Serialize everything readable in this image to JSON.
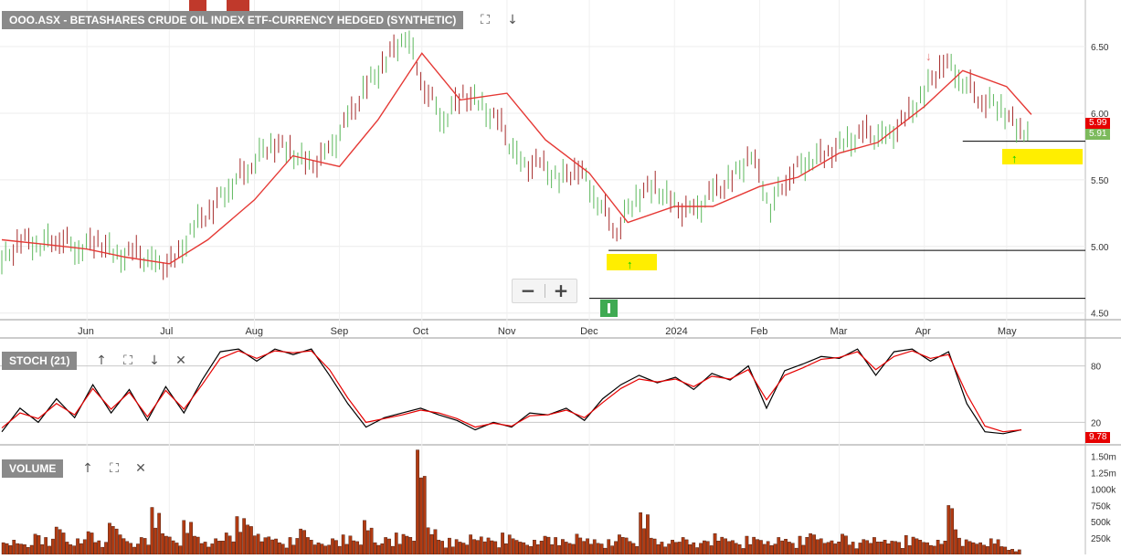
{
  "chart_data": [
    {
      "type": "line",
      "panel": "price",
      "title": "OOO.ASX - BETASHARES CRUDE OIL INDEX ETF-CURRENCY HEDGED (SYNTHETIC)",
      "x_tick_labels": [
        "Jun",
        "Jul",
        "Aug",
        "Sep",
        "Oct",
        "Nov",
        "Dec",
        "2024",
        "Feb",
        "Mar",
        "Apr",
        "May"
      ],
      "y_tick_labels": [
        "6.50",
        "6.00",
        "5.50",
        "5.00",
        "4.50"
      ],
      "ylim": [
        4.45,
        6.85
      ],
      "grid": true,
      "series": [
        {
          "role": "close",
          "color": "#4caf50",
          "points": [
            [
              "2023-05-01",
              4.88
            ],
            [
              "2023-05-08",
              5.05
            ],
            [
              "2023-05-15",
              5.02
            ],
            [
              "2023-05-22",
              5.07
            ],
            [
              "2023-05-29",
              4.98
            ],
            [
              "2023-06-05",
              5.05
            ],
            [
              "2023-06-12",
              4.92
            ],
            [
              "2023-06-19",
              4.95
            ],
            [
              "2023-06-26",
              4.85
            ],
            [
              "2023-07-03",
              4.88
            ],
            [
              "2023-07-10",
              5.15
            ],
            [
              "2023-07-17",
              5.3
            ],
            [
              "2023-07-24",
              5.48
            ],
            [
              "2023-07-31",
              5.62
            ],
            [
              "2023-08-07",
              5.78
            ],
            [
              "2023-08-14",
              5.72
            ],
            [
              "2023-08-21",
              5.6
            ],
            [
              "2023-08-28",
              5.7
            ],
            [
              "2023-09-04",
              5.95
            ],
            [
              "2023-09-11",
              6.2
            ],
            [
              "2023-09-18",
              6.4
            ],
            [
              "2023-09-25",
              6.6
            ],
            [
              "2023-10-02",
              6.2
            ],
            [
              "2023-10-09",
              5.95
            ],
            [
              "2023-10-16",
              6.15
            ],
            [
              "2023-10-23",
              6.05
            ],
            [
              "2023-10-30",
              5.9
            ],
            [
              "2023-11-06",
              5.6
            ],
            [
              "2023-11-13",
              5.62
            ],
            [
              "2023-11-20",
              5.5
            ],
            [
              "2023-11-27",
              5.6
            ],
            [
              "2023-12-04",
              5.35
            ],
            [
              "2023-12-11",
              5.12
            ],
            [
              "2023-12-18",
              5.38
            ],
            [
              "2023-12-25",
              5.45
            ],
            [
              "2024-01-01",
              5.3
            ],
            [
              "2024-01-08",
              5.25
            ],
            [
              "2024-01-15",
              5.4
            ],
            [
              "2024-01-22",
              5.5
            ],
            [
              "2024-01-29",
              5.7
            ],
            [
              "2024-02-05",
              5.3
            ],
            [
              "2024-02-12",
              5.55
            ],
            [
              "2024-02-19",
              5.65
            ],
            [
              "2024-02-26",
              5.7
            ],
            [
              "2024-03-04",
              5.78
            ],
            [
              "2024-03-11",
              5.85
            ],
            [
              "2024-03-18",
              5.8
            ],
            [
              "2024-03-25",
              5.95
            ],
            [
              "2024-04-01",
              6.15
            ],
            [
              "2024-04-08",
              6.4
            ],
            [
              "2024-04-15",
              6.25
            ],
            [
              "2024-04-22",
              6.1
            ],
            [
              "2024-04-29",
              6.05
            ],
            [
              "2024-05-06",
              5.85
            ],
            [
              "2024-05-10",
              5.91
            ]
          ]
        },
        {
          "role": "moving average",
          "color": "#e53935",
          "points": [
            [
              "2023-05-01",
              5.05
            ],
            [
              "2023-05-15",
              5.02
            ],
            [
              "2023-06-01",
              4.98
            ],
            [
              "2023-06-15",
              4.92
            ],
            [
              "2023-07-01",
              4.87
            ],
            [
              "2023-07-15",
              5.05
            ],
            [
              "2023-08-01",
              5.35
            ],
            [
              "2023-08-15",
              5.68
            ],
            [
              "2023-09-01",
              5.6
            ],
            [
              "2023-09-15",
              5.95
            ],
            [
              "2023-10-01",
              6.45
            ],
            [
              "2023-10-15",
              6.1
            ],
            [
              "2023-11-01",
              6.15
            ],
            [
              "2023-11-15",
              5.8
            ],
            [
              "2023-12-01",
              5.55
            ],
            [
              "2023-12-15",
              5.18
            ],
            [
              "2024-01-01",
              5.3
            ],
            [
              "2024-01-15",
              5.3
            ],
            [
              "2024-02-01",
              5.45
            ],
            [
              "2024-02-15",
              5.52
            ],
            [
              "2024-03-01",
              5.7
            ],
            [
              "2024-03-15",
              5.78
            ],
            [
              "2024-04-01",
              6.05
            ],
            [
              "2024-04-15",
              6.32
            ],
            [
              "2024-05-01",
              6.2
            ],
            [
              "2024-05-10",
              5.99
            ]
          ]
        }
      ],
      "horizontal_lines": [
        {
          "label": "resistance",
          "value": 5.79,
          "from": "2024-04-15",
          "to": "2024-05-31"
        },
        {
          "label": "support",
          "value": 4.97,
          "from": "2023-12-08",
          "to": "2024-05-31"
        },
        {
          "label": "low",
          "value": 4.61,
          "from": "2023-12-01",
          "to": "2024-05-31"
        }
      ],
      "price_labels": [
        {
          "text": "5.99",
          "color": "#e60000"
        },
        {
          "text": "5.91",
          "color": "#7cba5c"
        }
      ]
    },
    {
      "type": "line",
      "panel": "stochastic",
      "title": "STOCH (21)",
      "y_tick_labels": [
        "80",
        "20"
      ],
      "ylim": [
        0,
        100
      ],
      "series": [
        {
          "role": "%K",
          "color": "#000000",
          "values": [
            10,
            35,
            20,
            45,
            25,
            60,
            30,
            55,
            22,
            58,
            30,
            65,
            95,
            98,
            85,
            98,
            92,
            98,
            70,
            40,
            15,
            25,
            30,
            35,
            28,
            22,
            12,
            20,
            15,
            30,
            28,
            35,
            22,
            45,
            60,
            70,
            62,
            68,
            55,
            72,
            65,
            80,
            35,
            75,
            82,
            90,
            88,
            98,
            70,
            95,
            98,
            85,
            95,
            40,
            10,
            8,
            12
          ]
        },
        {
          "role": "%D",
          "color": "#e60000",
          "values": [
            14,
            30,
            24,
            40,
            28,
            56,
            34,
            52,
            26,
            54,
            34,
            60,
            88,
            96,
            88,
            96,
            94,
            96,
            76,
            46,
            20,
            24,
            28,
            33,
            30,
            24,
            15,
            19,
            16,
            27,
            28,
            33,
            25,
            41,
            56,
            66,
            63,
            66,
            58,
            69,
            66,
            76,
            44,
            70,
            78,
            87,
            89,
            95,
            76,
            90,
            96,
            88,
            92,
            50,
            16,
            10,
            12
          ]
        }
      ],
      "last_value_label": {
        "text": "9.78",
        "color": "#e60000"
      }
    },
    {
      "type": "bar",
      "panel": "volume",
      "title": "VOLUME",
      "y_tick_labels": [
        "1.50m",
        "1.25m",
        "1000k",
        "750k",
        "500k",
        "250k"
      ],
      "ylim": [
        0,
        1650000
      ],
      "color": "#b23b12",
      "values": [
        180000,
        220000,
        150000,
        310000,
        260000,
        420000,
        190000,
        240000,
        350000,
        210000,
        480000,
        300000,
        170000,
        260000,
        720000,
        320000,
        210000,
        520000,
        280000,
        190000,
        240000,
        330000,
        580000,
        450000,
        310000,
        270000,
        180000,
        260000,
        390000,
        220000,
        160000,
        240000,
        300000,
        210000,
        520000,
        180000,
        260000,
        330000,
        280000,
        1600000,
        410000,
        220000,
        250000,
        190000,
        300000,
        270000,
        210000,
        330000,
        240000,
        180000,
        220000,
        280000,
        260000,
        190000,
        310000,
        240000,
        170000,
        230000,
        300000,
        200000,
        640000,
        250000,
        190000,
        220000,
        260000,
        180000,
        210000,
        320000,
        240000,
        170000,
        280000,
        230000,
        200000,
        260000,
        190000,
        280000,
        320000,
        240000,
        210000,
        310000,
        190000,
        230000,
        260000,
        220000,
        200000,
        290000,
        240000,
        180000,
        220000,
        750000,
        250000,
        200000,
        180000,
        240000,
        120000,
        80000
      ]
    }
  ],
  "price_header": {
    "title": "OOO.ASX - BETASHARES CRUDE OIL INDEX ETF-CURRENCY HEDGED (SYNTHETIC)"
  },
  "stoch_header": {
    "title": "STOCH (21)"
  },
  "volume_header": {
    "title": "VOLUME"
  },
  "icons": {
    "expand": "expand-icon",
    "down": "arrow-down-icon",
    "up": "arrow-up-icon",
    "close": "close-icon",
    "zoom_out": "minus-icon",
    "zoom_in": "plus-icon"
  },
  "colors": {
    "highlight": "#ffee00",
    "signal_up": "#00cc00",
    "signal_down": "#e57373",
    "marker_green": "#3faa52",
    "marker_red": "#c0392b",
    "panel_label_bg": "#8a8a8a"
  }
}
